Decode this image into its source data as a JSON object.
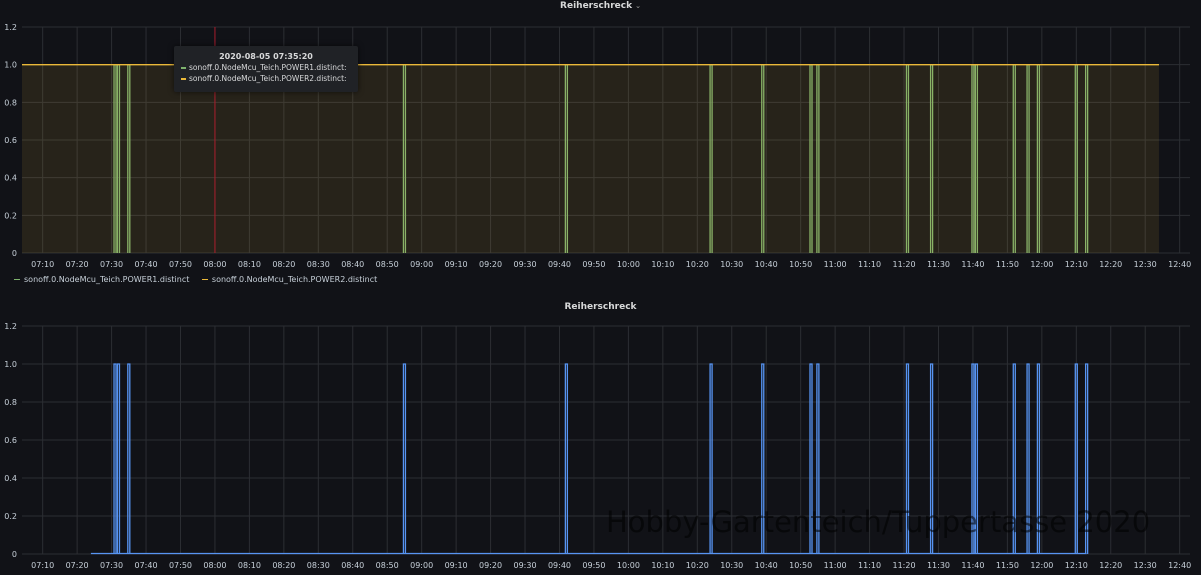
{
  "chart_data": [
    {
      "type": "line",
      "title": "Reiherschreck",
      "x_ticks": [
        "07:10",
        "07:20",
        "07:30",
        "07:40",
        "07:50",
        "08:00",
        "08:10",
        "08:20",
        "08:30",
        "08:40",
        "08:50",
        "09:00",
        "09:10",
        "09:20",
        "09:30",
        "09:40",
        "09:50",
        "10:00",
        "10:10",
        "10:20",
        "10:30",
        "10:40",
        "10:50",
        "11:00",
        "11:10",
        "11:20",
        "11:30",
        "11:40",
        "11:50",
        "12:00",
        "12:10",
        "12:20",
        "12:30",
        "12:40"
      ],
      "x_range": [
        "07:04",
        "12:43"
      ],
      "ylim": [
        0,
        1.2
      ],
      "y_ticks": [
        "0",
        "0.2",
        "0.4",
        "0.6",
        "0.8",
        "1.0",
        "1.2"
      ],
      "grid": true,
      "legend_position": "bottom-left",
      "series": [
        {
          "name": "sonoff.0.NodeMcu_Teich.POWER1.distinct",
          "color": "#7eb26d",
          "baseline": 0,
          "pulse_value": 1,
          "pulses": [
            "07:31",
            "07:32",
            "07:35",
            "08:55",
            "09:42",
            "10:24",
            "10:39",
            "10:53",
            "10:55",
            "11:21",
            "11:28",
            "11:40",
            "11:41",
            "11:52",
            "11:56",
            "11:59",
            "12:10",
            "12:13"
          ]
        },
        {
          "name": "sonoff.0.NodeMcu_Teich.POWER2.distinct",
          "color": "#eab839",
          "constant": 1,
          "from": "07:04",
          "to": "12:34"
        }
      ],
      "cursor_time": "08:00",
      "tooltip": {
        "time": "2020-08-05 07:35:20",
        "rows": [
          {
            "label": "sonoff.0.NodeMcu_Teich.POWER1.distinct:",
            "color": "#7eb26d"
          },
          {
            "label": "sonoff.0.NodeMcu_Teich.POWER2.distinct:",
            "color": "#eab839"
          }
        ]
      }
    },
    {
      "type": "line",
      "title": "Reiherschreck",
      "x_ticks": [
        "07:10",
        "07:20",
        "07:30",
        "07:40",
        "07:50",
        "08:00",
        "08:10",
        "08:20",
        "08:30",
        "08:40",
        "08:50",
        "09:00",
        "09:10",
        "09:20",
        "09:30",
        "09:40",
        "09:50",
        "10:00",
        "10:10",
        "10:20",
        "10:30",
        "10:40",
        "10:50",
        "11:00",
        "11:10",
        "11:20",
        "11:30",
        "11:40",
        "11:50",
        "12:00",
        "12:10",
        "12:20",
        "12:30",
        "12:40"
      ],
      "x_range": [
        "07:04",
        "12:43"
      ],
      "ylim": [
        0,
        1.2
      ],
      "y_ticks": [
        "0",
        "0.2",
        "0.4",
        "0.6",
        "0.8",
        "1.0",
        "1.2"
      ],
      "grid": true,
      "series": [
        {
          "color": "#5794f2",
          "baseline": 0,
          "baseline_from": "07:24",
          "baseline_to": "12:13",
          "pulse_value": 1,
          "pulses": [
            "07:31",
            "07:32",
            "07:35",
            "08:55",
            "09:42",
            "10:24",
            "10:39",
            "10:53",
            "10:55",
            "11:21",
            "11:28",
            "11:40",
            "11:41",
            "11:52",
            "11:56",
            "11:59",
            "12:10",
            "12:13"
          ]
        }
      ]
    }
  ],
  "watermark": "Hobby-Gartenteich/Tuppertasse 2020"
}
